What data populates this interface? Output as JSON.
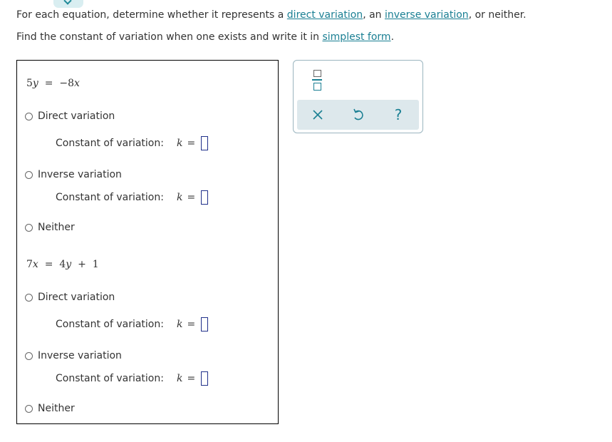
{
  "instructions": {
    "line1_prefix": "For each equation, determine whether it represents a ",
    "link_direct": "direct variation",
    "line1_mid": ", an ",
    "link_inverse": "inverse variation",
    "line1_suffix": ", or neither.",
    "line2_prefix": "Find the constant of variation when one exists and write it in ",
    "link_simplest": "simplest form",
    "line2_suffix": "."
  },
  "problems": [
    {
      "equation": {
        "lhs_coef": "5",
        "lhs_var": "y",
        "eq": "=",
        "rhs": "−8",
        "rhs_var": "x"
      },
      "options": {
        "direct": "Direct variation",
        "inverse": "Inverse variation",
        "neither": "Neither"
      },
      "const_label": "Constant of variation:",
      "k": "k",
      "equals": "="
    },
    {
      "equation": {
        "lhs_coef": "7",
        "lhs_var": "x",
        "eq": "=",
        "rhs_coef": "4",
        "rhs_var": "y",
        "plus": "+",
        "const": "1"
      },
      "options": {
        "direct": "Direct variation",
        "inverse": "Inverse variation",
        "neither": "Neither"
      },
      "const_label": "Constant of variation:",
      "k": "k",
      "equals": "="
    }
  ],
  "toolbar": {
    "icons": [
      "fraction-icon",
      "clear-icon",
      "undo-icon",
      "help-icon"
    ],
    "help_glyph": "?"
  },
  "colors": {
    "link": "#1a7f93",
    "accent": "#1a7f93",
    "answer_box": "#20308a",
    "tool_strip": "#dde8ec"
  }
}
